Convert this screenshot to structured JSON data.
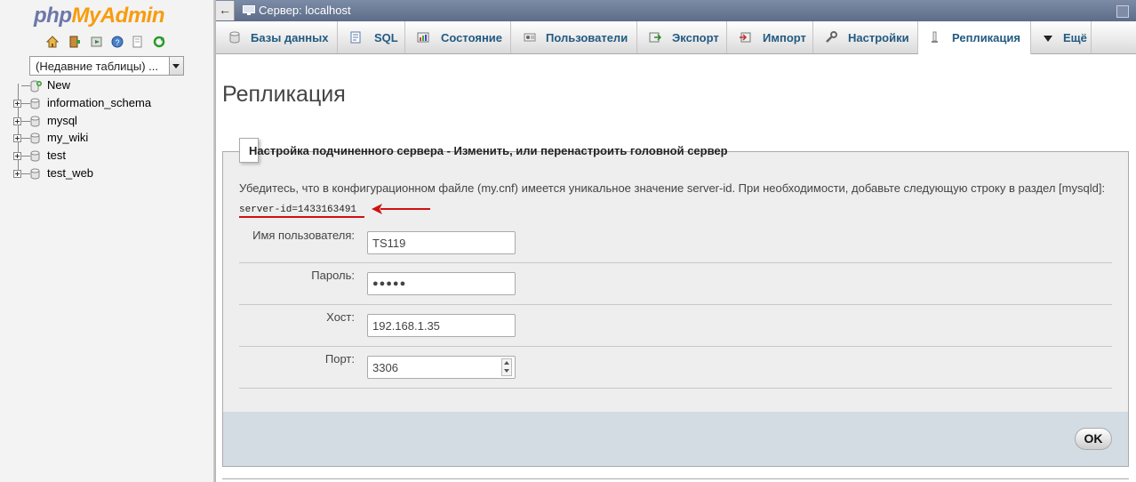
{
  "sidebar": {
    "logo_php": "php",
    "logo_myadmin": "MyAdmin",
    "nav_icons": [
      "home-icon",
      "exit-icon",
      "query-icon",
      "docs-icon",
      "copy-icon",
      "reload-icon"
    ],
    "recent_tables": "(Недавние таблицы) ...",
    "tree": [
      {
        "label": "New",
        "type": "new"
      },
      {
        "label": "information_schema",
        "type": "db"
      },
      {
        "label": "mysql",
        "type": "db"
      },
      {
        "label": "my_wiki",
        "type": "db"
      },
      {
        "label": "test",
        "type": "db"
      },
      {
        "label": "test_web",
        "type": "db"
      }
    ]
  },
  "header": {
    "back": "←",
    "server_title": "Сервер: localhost"
  },
  "tabs": [
    {
      "label": "Базы данных",
      "icon": "databases-icon"
    },
    {
      "label": "SQL",
      "icon": "sql-icon"
    },
    {
      "label": "Состояние",
      "icon": "status-icon"
    },
    {
      "label": "Пользователи",
      "icon": "users-icon"
    },
    {
      "label": "Экспорт",
      "icon": "export-icon"
    },
    {
      "label": "Импорт",
      "icon": "import-icon"
    },
    {
      "label": "Настройки",
      "icon": "settings-icon"
    },
    {
      "label": "Репликация",
      "icon": "replication-icon",
      "active": true
    },
    {
      "label": "Ещё",
      "icon": "more-icon"
    }
  ],
  "page": {
    "title": "Репликация",
    "legend": "Настройка подчиненного сервера - Изменить, или перенастроить головной сервер",
    "info": "Убедитесь, что в конфигурационном файле (my.cnf) имеется уникальное значение server-id. При необходимости, добавьте следующую строку в раздел [mysqld]:",
    "server_id_line": "server-id=1433163491",
    "form": {
      "username_label": "Имя пользователя:",
      "username_value": "TS119",
      "password_label": "Пароль:",
      "password_value": "●●●●●",
      "host_label": "Хост:",
      "host_value": "192.168.1.35",
      "port_label": "Порт:",
      "port_value": "3306"
    },
    "ok_label": "OK"
  },
  "colors": {
    "accent": "#235a81",
    "header_bar": "#6c7b98",
    "annotation_red": "#d01010"
  }
}
